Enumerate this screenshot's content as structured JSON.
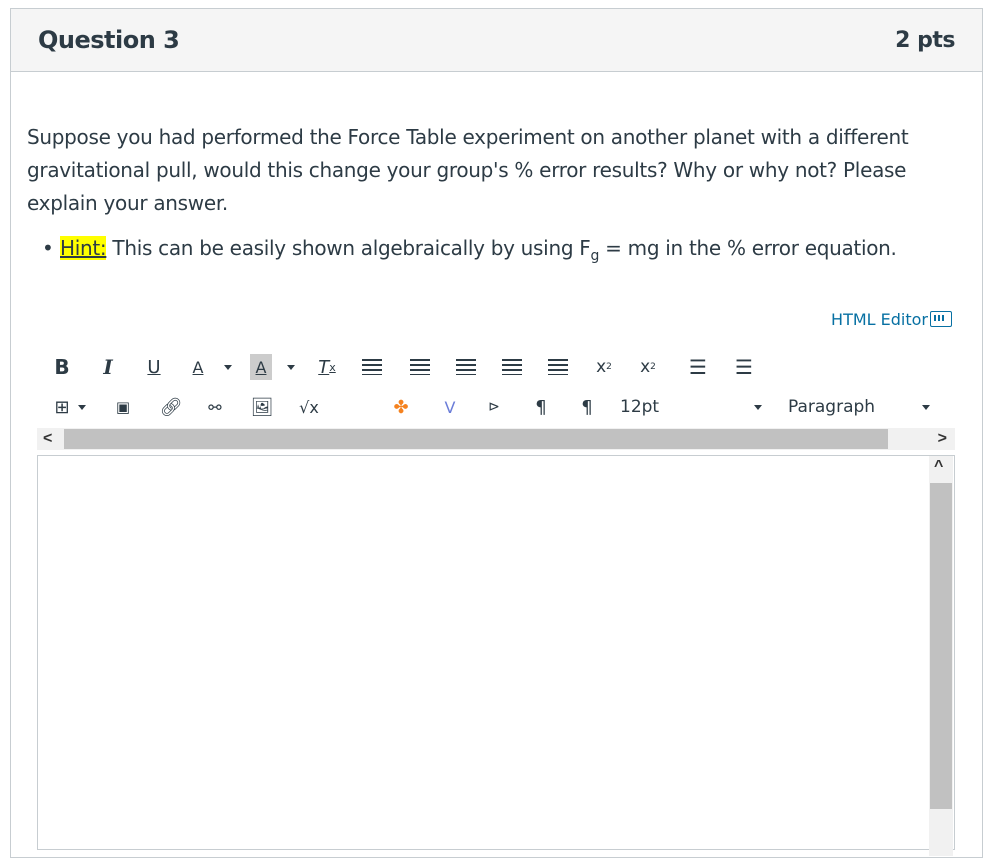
{
  "question": {
    "title": "Question 3",
    "points": "2 pts",
    "text": "Suppose you had performed the Force Table experiment on another planet with a different gravitational pull, would this change your group's % error results?  Why or why not?  Please explain your answer.",
    "hint_label": "Hint:",
    "hint_text_before": " This can be easily shown algebraically by using F",
    "hint_subscript": "g",
    "hint_text_after": " = mg in the % error equation."
  },
  "editor": {
    "html_editor_label": "HTML Editor",
    "font_size": "12pt",
    "block_format": "Paragraph"
  },
  "colors": {
    "link": "#0770a3",
    "highlight": "#ffff00",
    "text": "#2d3b45"
  }
}
